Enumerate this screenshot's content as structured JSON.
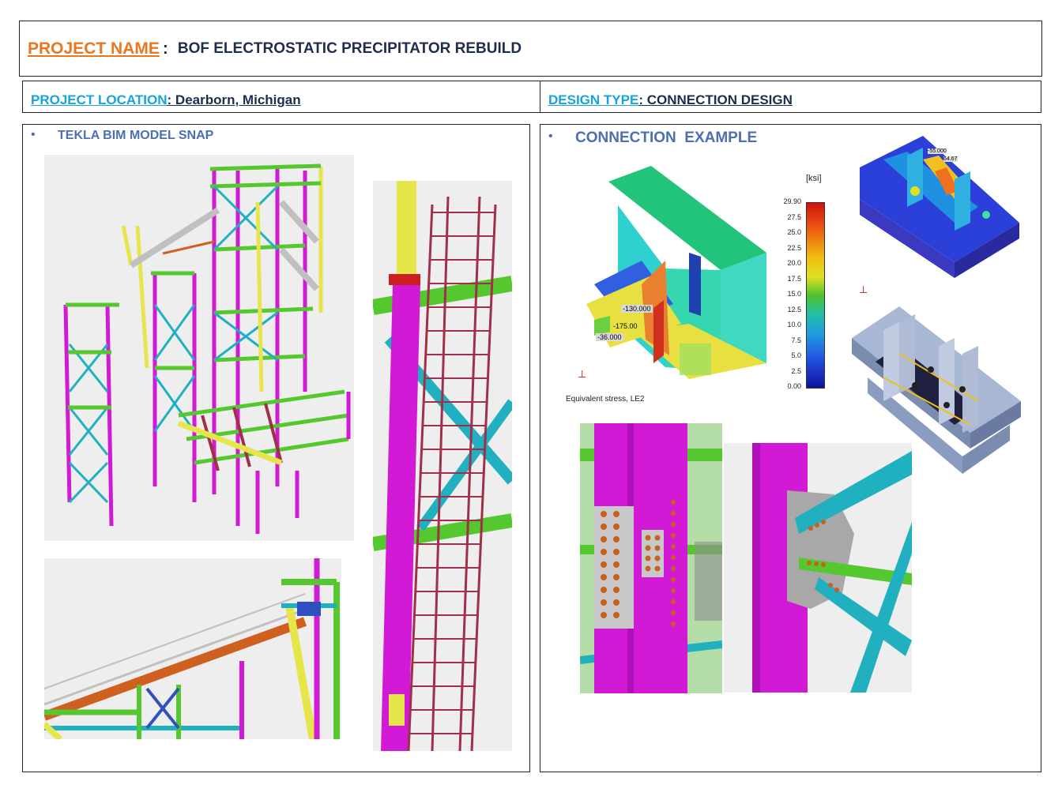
{
  "header": {
    "project_name_label": "PROJECT NAME ",
    "colon": ":",
    "project_name_value": "BOF ELECTROSTATIC PRECIPITATOR REBUILD"
  },
  "location": {
    "label": "PROJECT LOCATION",
    "value": ": Dearborn, Michigan"
  },
  "design_type": {
    "label": "DESIGN TYPE",
    "value": ": CONNECTION DESIGN"
  },
  "left_panel": {
    "bullet": "•",
    "title": "TEKLA BIM MODEL SNAP"
  },
  "right_panel": {
    "bullet": "•",
    "title": "CONNECTION  EXAMPLE"
  },
  "stress_plot": {
    "unit": "[ksi]",
    "scale_labels": [
      "29.90",
      "27.5",
      "25.0",
      "22.5",
      "20.0",
      "17.5",
      "15.0",
      "12.5",
      "10.0",
      "7.5",
      "5.0",
      "2.5",
      "0.00"
    ],
    "annotations": [
      "-130.000",
      "-175.00",
      "-36.000"
    ],
    "caption": "Equivalent stress, LE2",
    "small_plot_annotations": [
      "-55.000",
      "64.67"
    ]
  },
  "colors": {
    "project_name_label": "#e87722",
    "navy_text": "#1f2d4d",
    "cyan_label": "#1aa3d9",
    "section_title": "#4b6fb0",
    "magenta_member": "#d21ad6",
    "green_member": "#55c830",
    "teal_member": "#20b0c0",
    "yellow_member": "#e6e64a"
  }
}
